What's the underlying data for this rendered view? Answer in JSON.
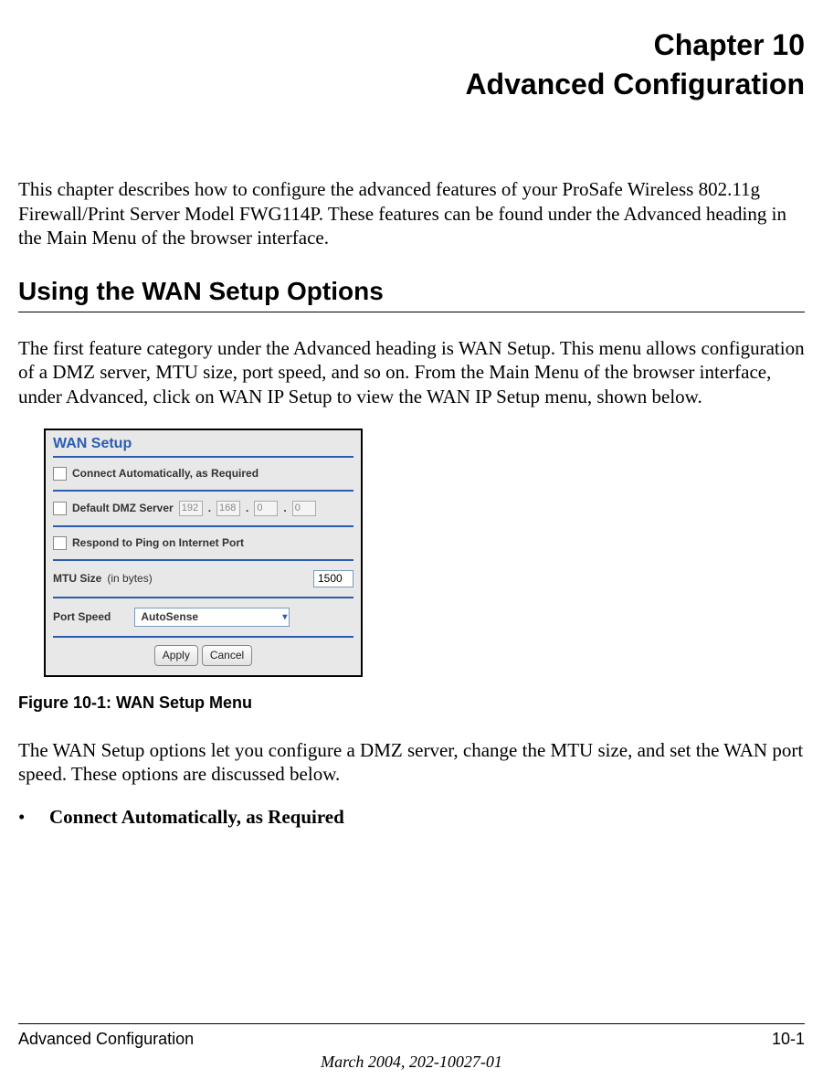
{
  "chapter": {
    "line1": "Chapter 10",
    "line2": "Advanced Configuration"
  },
  "intro_paragraph": "This chapter describes how to configure the advanced features of your ProSafe Wireless 802.11g Firewall/Print Server Model FWG114P. These features can be found under the Advanced heading in the Main Menu of the browser interface.",
  "section_heading": "Using the WAN Setup Options",
  "section_paragraph": "The first feature category under the Advanced heading is WAN Setup. This menu allows configuration of a DMZ server, MTU size, port speed, and so on. From the Main Menu of the browser interface, under Advanced, click on WAN IP Setup to view the WAN IP Setup menu, shown below.",
  "wan_panel": {
    "title": "WAN Setup",
    "connect_auto_label": "Connect Automatically, as Required",
    "dmz_label": "Default DMZ Server",
    "dmz_ip": {
      "o1": "192",
      "o2": "168",
      "o3": "0",
      "o4": "0"
    },
    "respond_ping_label": "Respond to Ping on Internet Port",
    "mtu_label": "MTU Size",
    "mtu_unit": "(in bytes)",
    "mtu_value": "1500",
    "port_speed_label": "Port Speed",
    "port_speed_value": "AutoSense",
    "apply_label": "Apply",
    "cancel_label": "Cancel"
  },
  "figure_caption": "Figure 10-1:  WAN Setup Menu",
  "post_figure_paragraph": "The WAN Setup options let you configure a DMZ server, change the MTU size, and set the WAN port speed. These options are discussed below.",
  "bullet1": "Connect Automatically, as Required",
  "footer": {
    "left": "Advanced Configuration",
    "right": "10-1",
    "bottom": "March 2004, 202-10027-01"
  }
}
